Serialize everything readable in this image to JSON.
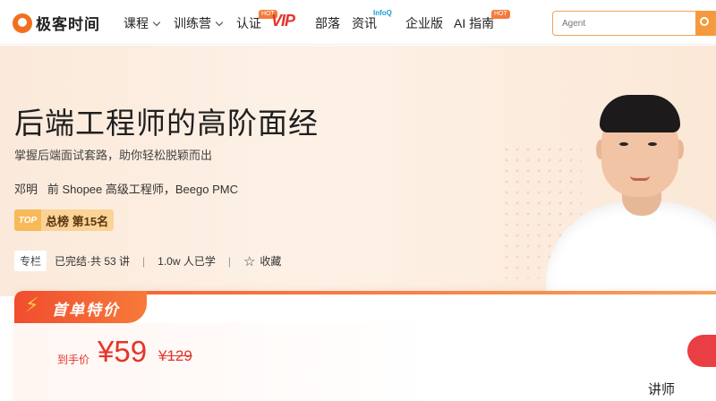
{
  "nav": {
    "logo": "极客时间",
    "items": [
      {
        "label": "课程"
      },
      {
        "label": "训练营"
      },
      {
        "label": "认证"
      },
      {
        "label": "部落"
      },
      {
        "label": "资讯"
      },
      {
        "label": "企业版"
      },
      {
        "label": "AI 指南"
      }
    ],
    "hot_badge": "HOT",
    "vip": "VIP",
    "infoq": "InfoQ",
    "search_placeholder": "Agent"
  },
  "hero": {
    "title": "后端工程师的高阶面经",
    "subtitle": "掌握后端面试套路，助你轻松脱颖而出",
    "author": "邓明   前 Shopee 高级工程师，Beego PMC",
    "rank_icon": "TOP",
    "rank_text": "总榜  第15名",
    "tag": "专栏",
    "status": "已完结·共 53 讲",
    "learners": "1.0w 人已学",
    "favorite": "收藏"
  },
  "price": {
    "promo_label": "首单特价",
    "prefix": "到手价",
    "current": "¥59",
    "original": "¥129"
  },
  "lecturer_label": "讲师",
  "colors": {
    "accent": "#f2701d",
    "price_red": "#e5352b",
    "hero_bg": "#fbeadb"
  }
}
